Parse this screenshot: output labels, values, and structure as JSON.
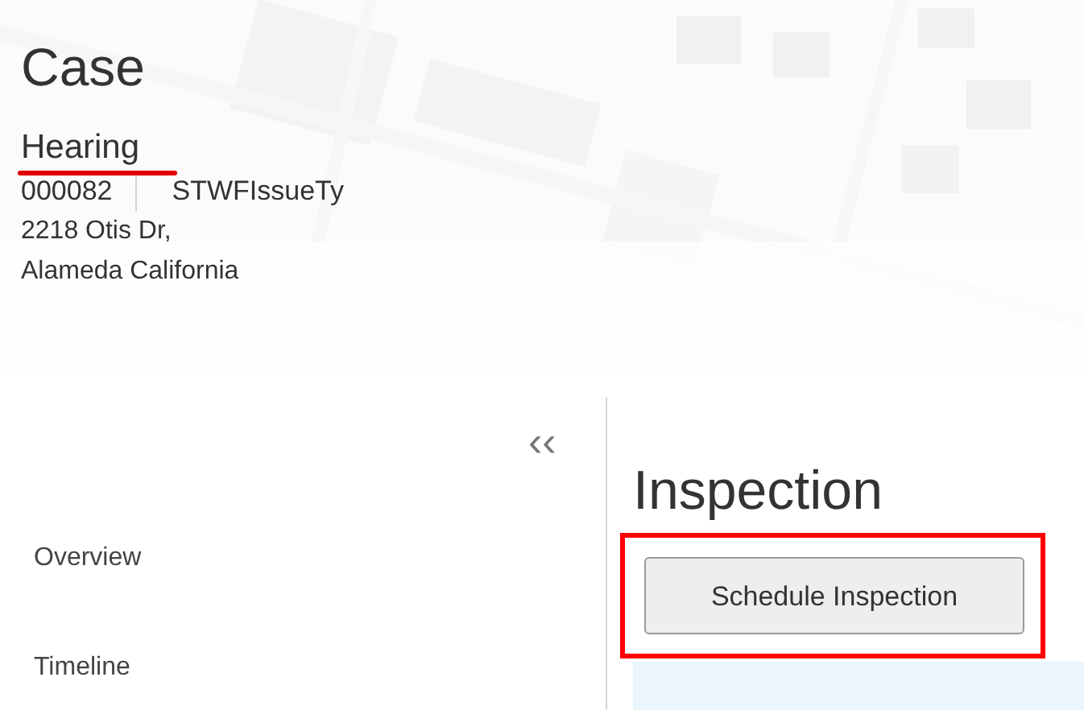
{
  "header": {
    "title": "Case",
    "status": "Hearing",
    "case_number": "000082",
    "issue_type": "STWFIssueTy",
    "address_line_1": "2218 Otis Dr,",
    "address_line_2": "Alameda California"
  },
  "sidebar": {
    "collapse": "‹‹",
    "items": [
      {
        "label": "Overview"
      },
      {
        "label": "Timeline"
      }
    ]
  },
  "content": {
    "title": "Inspection",
    "button": "Schedule Inspection"
  }
}
